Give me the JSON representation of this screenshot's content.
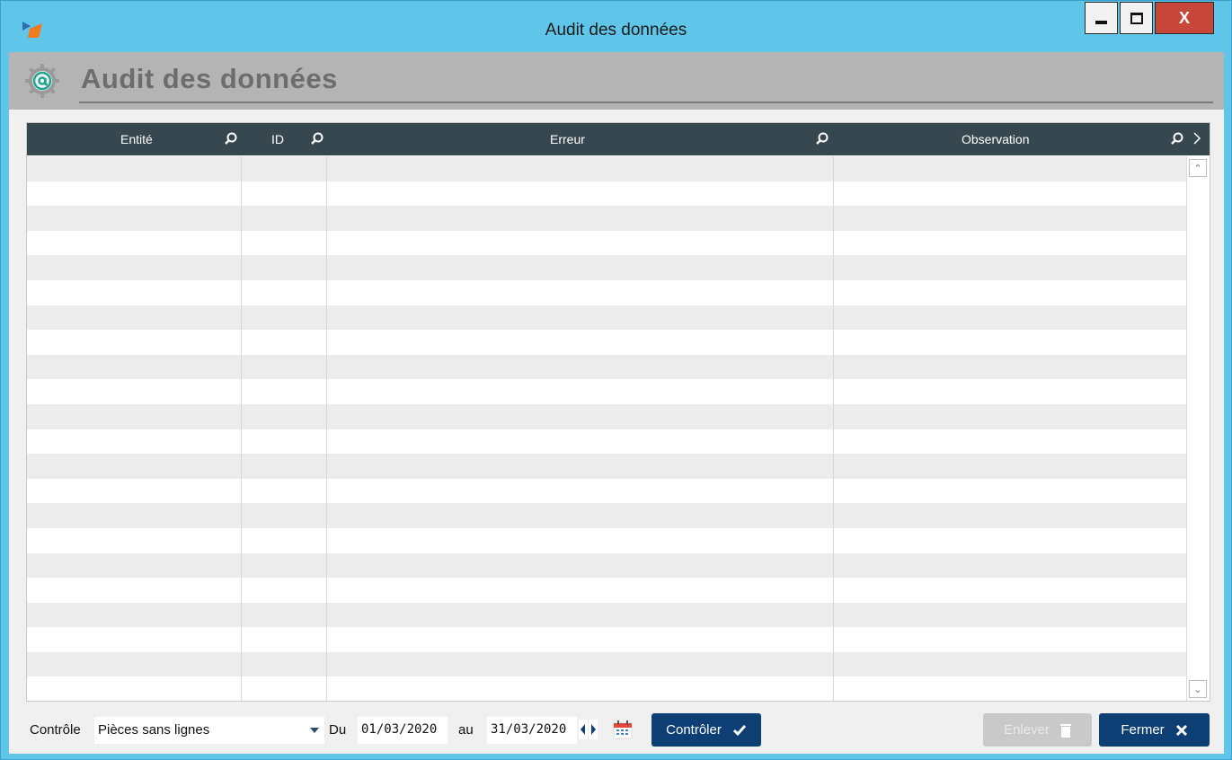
{
  "window": {
    "title": "Audit des données",
    "close_label": "X"
  },
  "header": {
    "title": "Audit des données"
  },
  "grid": {
    "columns": [
      {
        "label": "Entité"
      },
      {
        "label": "ID"
      },
      {
        "label": "Erreur"
      },
      {
        "label": "Observation"
      }
    ],
    "rows": []
  },
  "footer": {
    "controle_label": "Contrôle",
    "controle_value": "Pièces sans lignes",
    "du_label": "Du",
    "date_from": "01/03/2020",
    "au_label": "au",
    "date_to": "31/03/2020",
    "controler_button": "Contrôler",
    "enlever_button": "Enlever",
    "fermer_button": "Fermer"
  },
  "colors": {
    "titlebar": "#5fc6ea",
    "grid_header": "#37474f",
    "primary_button": "#0d3f75",
    "close_button": "#c7463a"
  }
}
